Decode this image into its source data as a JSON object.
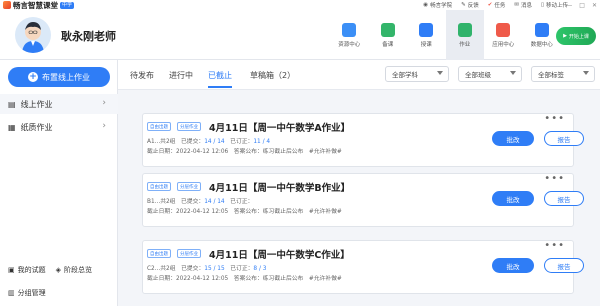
{
  "app": {
    "name": "畅言智慧课堂",
    "edition": "中学"
  },
  "top_links": [
    {
      "icon": "school-icon",
      "label": "畅言学院"
    },
    {
      "icon": "feedback-icon",
      "label": "反馈"
    },
    {
      "icon": "task-icon",
      "label": "任务"
    },
    {
      "icon": "message-icon",
      "label": "消息"
    },
    {
      "icon": "mobile-upload-icon",
      "label": "移动上传"
    }
  ],
  "window_controls": {
    "minimize": "—",
    "maximize": "□",
    "close": "✕"
  },
  "teacher": {
    "name": "耿永刚老师"
  },
  "toolbar": [
    {
      "icon": "resource-center-icon",
      "label": "资源中心",
      "color": "#3b8ff6"
    },
    {
      "icon": "lesson-prep-icon",
      "label": "备课",
      "color": "#33b56a"
    },
    {
      "icon": "teaching-icon",
      "label": "授课",
      "color": "#2f7df6"
    },
    {
      "icon": "homework-icon",
      "label": "作业",
      "color": "#30b36b"
    },
    {
      "icon": "app-center-icon",
      "label": "应用中心",
      "color": "#ef5a4a"
    },
    {
      "icon": "data-center-icon",
      "label": "数据中心",
      "color": "#2f7df6"
    }
  ],
  "live_button": {
    "label": "开始上课"
  },
  "sidebar": {
    "publish_label": "布置线上作业",
    "items": [
      {
        "icon": "online-homework-icon",
        "label": "线上作业"
      },
      {
        "icon": "paper-homework-icon",
        "label": "纸质作业"
      }
    ],
    "bottom": [
      {
        "icon": "my-questions-icon",
        "label": "我的试题"
      },
      {
        "icon": "stage-overview-icon",
        "label": "阶段总览"
      },
      {
        "icon": "group-manage-icon",
        "label": "分组管理"
      }
    ]
  },
  "tabs": {
    "pending": "待发布",
    "ongoing": "进行中",
    "ended": "已截止",
    "drafts": "草稿箱（2）"
  },
  "filters": {
    "subject": "全部学科",
    "class": "全部班级",
    "label": "全部标签"
  },
  "cards": [
    {
      "tags": [
        "自由出题",
        "分层作业"
      ],
      "title": "4月11日【周一中午数学A作业】",
      "row1": {
        "groups": "A1...共2组",
        "submitted_label": "已提交：",
        "submitted": "14 / 14",
        "corrected_label": "已订正：",
        "corrected": "11 / 4"
      },
      "row2": {
        "deadline": "截止日期：2022-04-12 12:06",
        "answer": "答案公布：练习截止后公布",
        "flag": "#允许补做#"
      },
      "grade_label": "批改",
      "report_label": "报告"
    },
    {
      "tags": [
        "自由出题",
        "分层作业"
      ],
      "title": "4月11日【周一中午数学B作业】",
      "row1": {
        "groups": "B1...共2组",
        "submitted_label": "已提交：",
        "submitted": "14 / 14",
        "corrected_label": "已订正：",
        "corrected": ""
      },
      "row2": {
        "deadline": "截止日期：2022-04-12 12:05",
        "answer": "答案公布：练习截止后公布",
        "flag": "#允许补做#"
      },
      "grade_label": "批改",
      "report_label": "报告"
    },
    {
      "tags": [
        "自由出题",
        "分层作业"
      ],
      "title": "4月11日【周一中午数学C作业】",
      "row1": {
        "groups": "C2...共2组",
        "submitted_label": "已提交：",
        "submitted": "15 / 15",
        "corrected_label": "已订正：",
        "corrected": "8 / 3"
      },
      "row2": {
        "deadline": "截止日期：2022-04-12 12:05",
        "answer": "答案公布：练习截止后公布",
        "flag": "#允许补做#"
      },
      "grade_label": "批改",
      "report_label": "报告"
    }
  ],
  "card_more": "•••"
}
